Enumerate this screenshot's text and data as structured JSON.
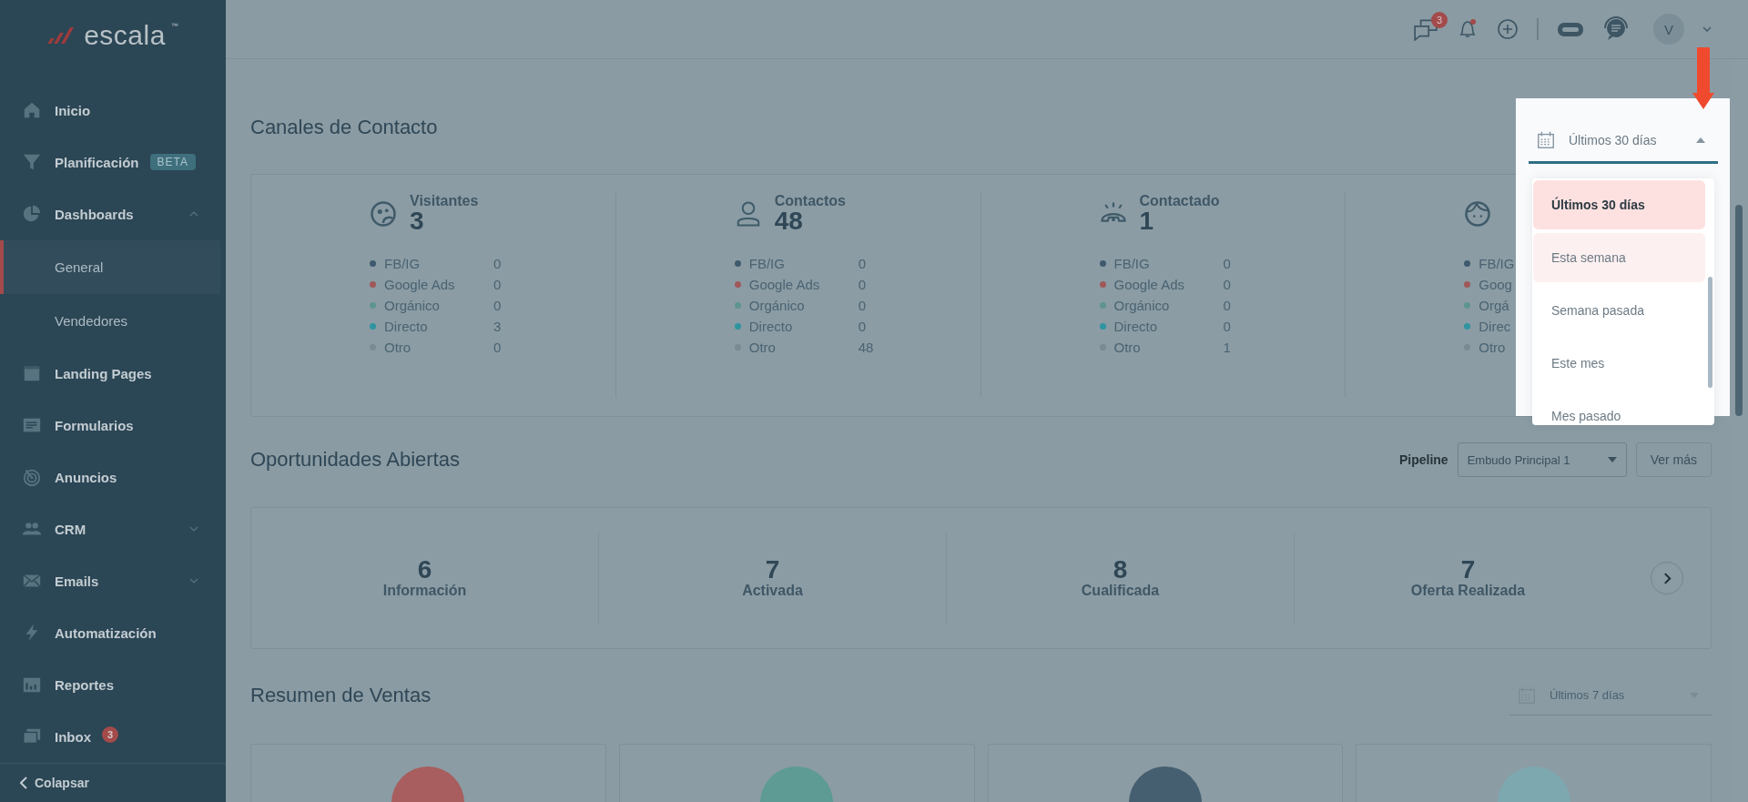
{
  "sidebar": {
    "logo": "escala",
    "logo_mark": "™",
    "items": [
      {
        "label": "Inicio",
        "kind": "item",
        "selected": false
      },
      {
        "label": "Planificación",
        "kind": "item",
        "selected": false,
        "badge": "BETA"
      },
      {
        "label": "Dashboards",
        "kind": "group",
        "selected": false,
        "expanded": true
      },
      {
        "label": "General",
        "kind": "sub",
        "selected": true
      },
      {
        "label": "Vendedores",
        "kind": "sub",
        "selected": false
      },
      {
        "label": "Landing Pages",
        "kind": "item",
        "selected": false
      },
      {
        "label": "Formularios",
        "kind": "item",
        "selected": false
      },
      {
        "label": "Anuncios",
        "kind": "item",
        "selected": false
      },
      {
        "label": "CRM",
        "kind": "group",
        "selected": false,
        "expanded": false
      },
      {
        "label": "Emails",
        "kind": "group",
        "selected": false,
        "expanded": false
      },
      {
        "label": "Automatización",
        "kind": "item",
        "selected": false
      },
      {
        "label": "Reportes",
        "kind": "item",
        "selected": false
      },
      {
        "label": "Inbox",
        "kind": "item",
        "selected": false,
        "count": "3"
      }
    ],
    "collapse": "Colapsar"
  },
  "header": {
    "messages_badge": "3",
    "bell_alert": true,
    "avatar": "V"
  },
  "contact_channels": {
    "title": "Canales de Contacto",
    "date_select": {
      "value": "Últimos 30 días",
      "expanded": true,
      "options": [
        {
          "label": "Últimos 30 días",
          "selected": true,
          "highlighted": false
        },
        {
          "label": "Esta semana",
          "selected": false,
          "highlighted": true
        },
        {
          "label": "Semana pasada",
          "selected": false,
          "highlighted": false
        },
        {
          "label": "Este mes",
          "selected": false,
          "highlighted": false
        },
        {
          "label": "Mes pasado",
          "selected": false,
          "highlighted": false
        }
      ]
    },
    "cards": [
      {
        "title": "Visitantes",
        "total": "3",
        "rows": [
          {
            "label": "FB/IG",
            "value": "0",
            "color": "#3f5a6d"
          },
          {
            "label": "Google Ads",
            "value": "0",
            "color": "#a05858"
          },
          {
            "label": "Orgánico",
            "value": "0",
            "color": "#5e9490"
          },
          {
            "label": "Directo",
            "value": "3",
            "color": "#2e94a0"
          },
          {
            "label": "Otro",
            "value": "0",
            "color": "#7a8a92"
          }
        ]
      },
      {
        "title": "Contactos",
        "total": "48",
        "rows": [
          {
            "label": "FB/IG",
            "value": "0",
            "color": "#3f5a6d"
          },
          {
            "label": "Google Ads",
            "value": "0",
            "color": "#a05858"
          },
          {
            "label": "Orgánico",
            "value": "0",
            "color": "#5e9490"
          },
          {
            "label": "Directo",
            "value": "0",
            "color": "#2e94a0"
          },
          {
            "label": "Otro",
            "value": "48",
            "color": "#7a8a92"
          }
        ]
      },
      {
        "title": "Contactado",
        "total": "1",
        "rows": [
          {
            "label": "FB/IG",
            "value": "0",
            "color": "#3f5a6d"
          },
          {
            "label": "Google Ads",
            "value": "0",
            "color": "#a05858"
          },
          {
            "label": "Orgánico",
            "value": "0",
            "color": "#5e9490"
          },
          {
            "label": "Directo",
            "value": "0",
            "color": "#2e94a0"
          },
          {
            "label": "Otro",
            "value": "1",
            "color": "#7a8a92"
          }
        ]
      },
      {
        "rows": [
          {
            "label": "FB/IG",
            "color": "#3f5a6d"
          },
          {
            "label": "Goog",
            "color": "#a05858"
          },
          {
            "label": "Orgá",
            "color": "#5e9490"
          },
          {
            "label": "Direc",
            "color": "#2e94a0"
          },
          {
            "label": "Otro",
            "color": "#7a8a92"
          }
        ]
      }
    ]
  },
  "opportunities": {
    "title": "Oportunidades Abiertas",
    "pipeline_label": "Pipeline",
    "pipeline_select": "Embudo Principal 1",
    "more_button": "Ver más",
    "stages": [
      {
        "count": "6",
        "label": "Información"
      },
      {
        "count": "7",
        "label": "Activada"
      },
      {
        "count": "8",
        "label": "Cualificada"
      },
      {
        "count": "7",
        "label": "Oferta Realizada"
      }
    ]
  },
  "sales_summary": {
    "title": "Resumen de Ventas",
    "date_select": {
      "value": "Últimos 7 días",
      "expanded": false
    },
    "cards": [
      {
        "color": "#a85e5e"
      },
      {
        "color": "#5d9b94"
      },
      {
        "color": "#455f70"
      },
      {
        "color": "#7ea8b0"
      }
    ]
  }
}
